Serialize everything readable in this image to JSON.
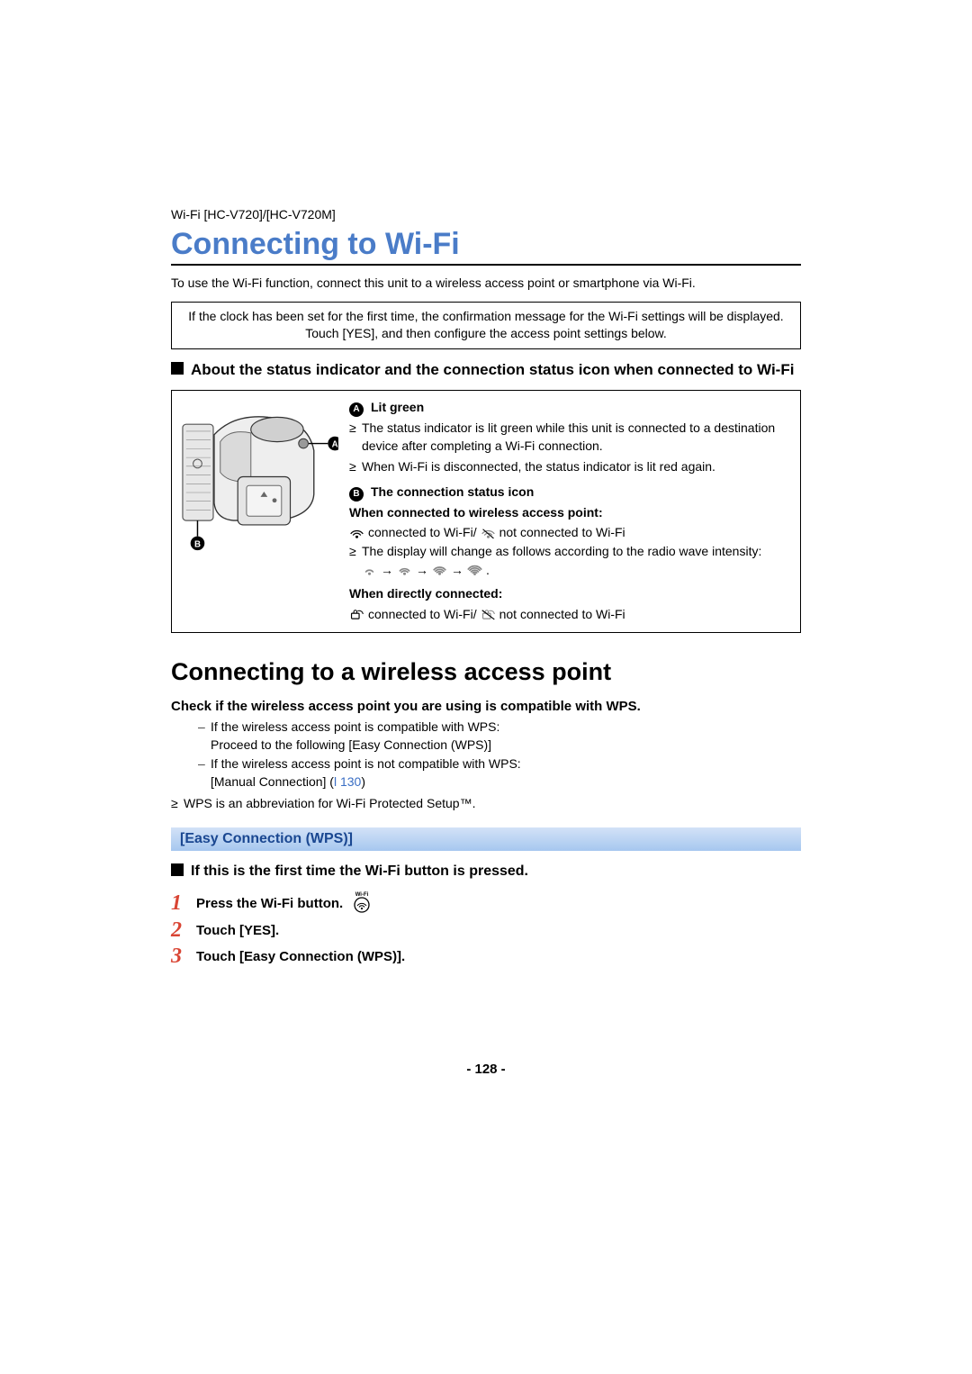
{
  "breadcrumb": "Wi-Fi [HC-V720]/[HC-V720M]",
  "title": "Connecting to Wi-Fi",
  "intro": "To use the Wi-Fi function, connect this unit to a wireless access point or smartphone via Wi-Fi.",
  "notice": "If the clock has been set for the first time, the confirmation message for the Wi-Fi settings will be displayed. Touch [YES], and then configure the access point settings below.",
  "sq1": "About the status indicator and the connection status icon when connected to Wi-Fi",
  "labelA": {
    "marker": "A",
    "title": "Lit green"
  },
  "a_bullets": [
    "The status indicator is lit green while this unit is connected to a destination device after completing a Wi-Fi connection.",
    "When Wi-Fi is disconnected, the status indicator is lit red again."
  ],
  "labelB": {
    "marker": "B",
    "title": "The connection status icon"
  },
  "b_sub1": "When connected to wireless access point:",
  "b_conn_text": " connected to Wi-Fi/",
  "b_notconn_text": " not connected to Wi-Fi",
  "b_radio": "The display will change as follows according to the radio wave intensity: ",
  "b_sub2": "When directly connected:",
  "section2": "Connecting to a wireless access point",
  "check": "Check if the wireless access point you are using is compatible with WPS.",
  "dash": [
    "If the wireless access point is compatible with WPS:",
    "Proceed to the following [Easy Connection (WPS)]",
    "If the wireless access point is not compatible with WPS:"
  ],
  "manual_link_pre": "[Manual Connection] (",
  "manual_link_arrow": "l",
  "manual_link_page": "130",
  "manual_link_post": ")",
  "wps_note": "WPS is an abbreviation for Wi-Fi Protected Setup™.",
  "method_banner": "[Easy Connection (WPS)]",
  "sq2": "If this is the first time the Wi-Fi button is pressed.",
  "steps": [
    {
      "num": "1",
      "text": "Press the Wi-Fi button."
    },
    {
      "num": "2",
      "text": "Touch [YES]."
    },
    {
      "num": "3",
      "text": "Touch [Easy Connection (WPS)]."
    }
  ],
  "wifi_btn_caption": "Wi-Fi",
  "page_num": "- 128 -"
}
